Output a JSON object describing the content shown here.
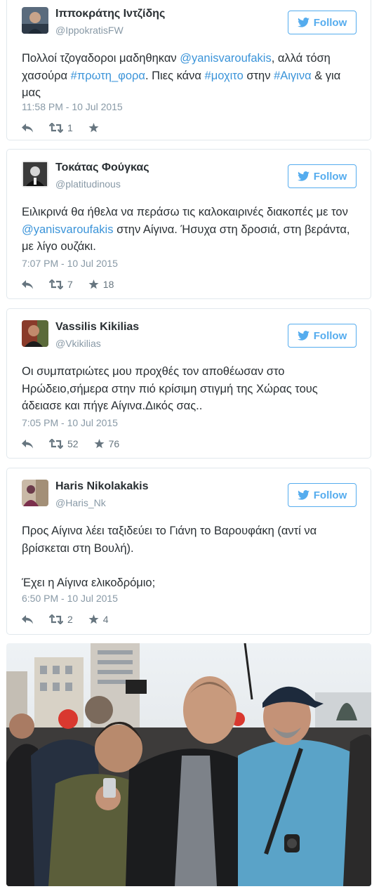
{
  "colors": {
    "accent": "#55acee",
    "link": "#3b94d9",
    "meta": "#8899a6",
    "text": "#292f33"
  },
  "follow_label": "Follow",
  "tweets": [
    {
      "name": "Ιπποκράτης Ιντζίδης",
      "handle": "@IppokratisFW",
      "text_parts": [
        "Πολλοί τζογαδοροι μαδηθηκαν ",
        "@yanisvaroufakis",
        ", αλλά τόση χασούρα ",
        "#πρωτη_φορα",
        ". Πιες κάνα ",
        "#μοχιτο",
        " στην ",
        "#Αιγινα",
        " & για μας"
      ],
      "timestamp": "11:58 PM - 10 Jul 2015",
      "retweets": "1",
      "favorites": ""
    },
    {
      "name": "Τοκάτας Φούγκας",
      "handle": "@platitudinous",
      "text_parts": [
        "Ειλικρινά θα ήθελα να περάσω τις καλοκαιρινές διακοπές με τον ",
        "@yanisvaroufakis",
        " στην Αίγινα. Ήσυχα στη δροσιά, στη βεράντα, με λίγο ουζάκι."
      ],
      "timestamp": "7:07 PM - 10 Jul 2015",
      "retweets": "7",
      "favorites": "18"
    },
    {
      "name": "Vassilis Kikilias",
      "handle": "@Vkikilias",
      "text_lines": [
        "Οι συμπατριώτες μου προχθές τον αποθέωσαν στο",
        "Ηρώδειο,σήμερα στην πιό κρίσιμη στιγμή της Χώρας τους",
        "άδειασε και πήγε Αίγινα.Δικός σας.."
      ],
      "timestamp": "7:05 PM - 10 Jul 2015",
      "retweets": "52",
      "favorites": "76"
    },
    {
      "name": "Haris Nikolakakis",
      "handle": "@Haris_Nk",
      "text_lines": [
        "Προς Αίγινα λέει ταξιδεύει το Γιάνη το Βαρουφάκη (αντί να",
        "βρίσκεται στη Βουλή).",
        "",
        "Έχει η Αίγινα ελικοδρόμιο;"
      ],
      "timestamp": "6:50 PM - 10 Jul 2015",
      "retweets": "2",
      "favorites": "4"
    }
  ]
}
